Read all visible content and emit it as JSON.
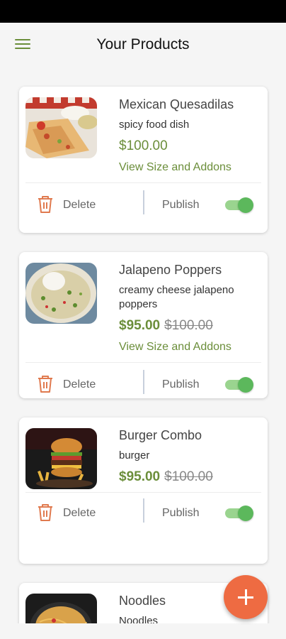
{
  "header": {
    "title": "Your Products"
  },
  "actions": {
    "delete_label": "Delete",
    "publish_label": "Publish"
  },
  "products": [
    {
      "name": "Mexican Quesadilas",
      "description": "spicy food dish",
      "price": "$100.00",
      "addons_label": "View Size and Addons",
      "published": true
    },
    {
      "name": "Jalapeno Poppers",
      "description": "creamy cheese jalapeno poppers",
      "price": "$95.00",
      "original_price": "$100.00",
      "addons_label": "View Size and Addons",
      "published": true
    },
    {
      "name": "Burger Combo",
      "description": "burger",
      "price": "$95.00",
      "original_price": "$100.00",
      "published": true
    },
    {
      "name": "Noodles",
      "description": "Noodles"
    }
  ],
  "colors": {
    "accent_green": "#6b8e3a",
    "delete_orange": "#e07a4f",
    "fab_orange": "#ee6b42",
    "toggle_on": "#5cb85c"
  },
  "icons": {
    "menu": "hamburger-icon",
    "delete": "trash-icon",
    "add": "plus-icon"
  }
}
